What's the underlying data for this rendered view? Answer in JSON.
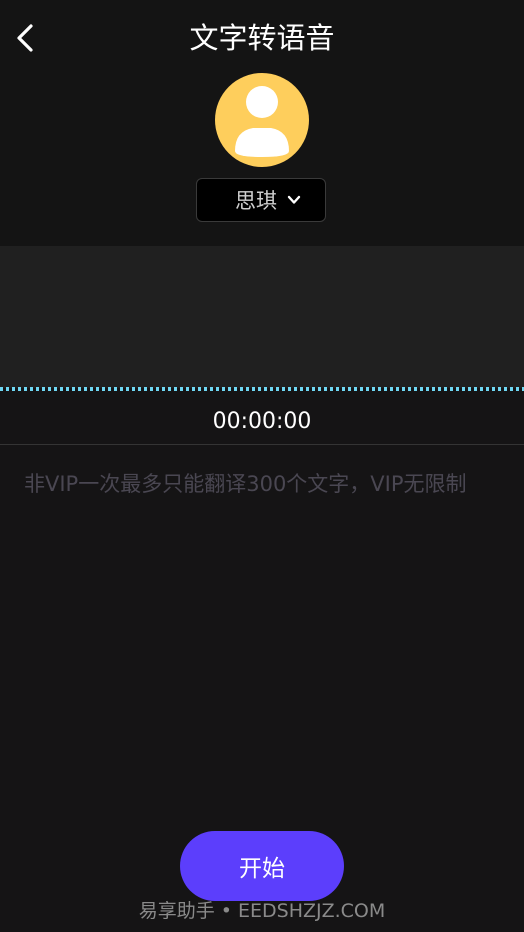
{
  "header": {
    "title": "文字转语音",
    "back_icon": "chevron-left-icon"
  },
  "voice": {
    "avatar_icon": "user-avatar-icon",
    "selected": "思琪",
    "dropdown_icon": "chevron-down-icon"
  },
  "player": {
    "time": "00:00:00"
  },
  "editor": {
    "value": "",
    "placeholder": "非VIP一次最多只能翻译300个文字，VIP无限制"
  },
  "actions": {
    "start_label": "开始"
  },
  "watermark": {
    "text": "易享助手 • EEDSHZJZ.COM"
  },
  "colors": {
    "background": "#151415",
    "wave_bg": "#202020",
    "wave_line": "#6fd7f3",
    "avatar": "#fece5c",
    "accent": "#5c3efc"
  }
}
